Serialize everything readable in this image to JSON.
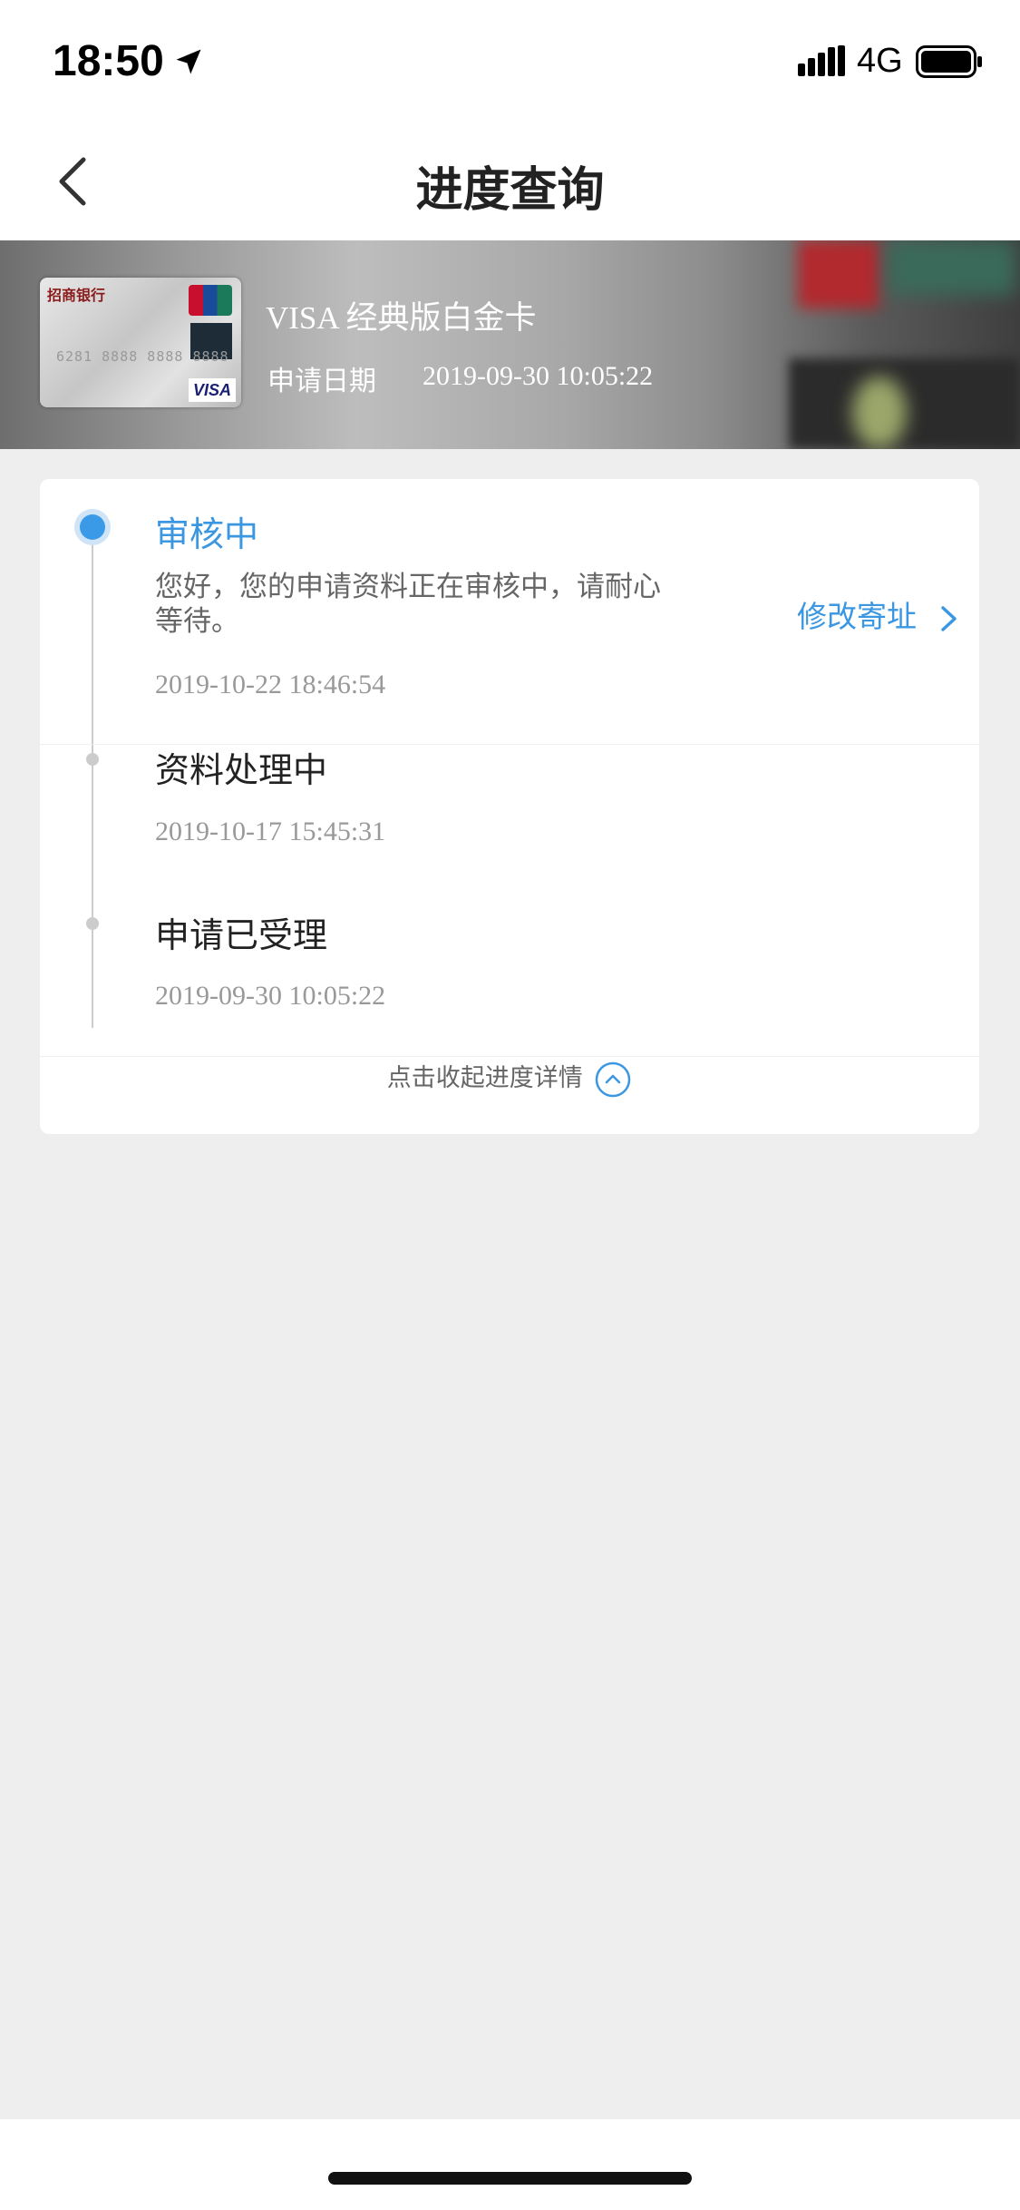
{
  "status_bar": {
    "time": "18:50",
    "network": "4G"
  },
  "nav": {
    "title": "进度查询"
  },
  "card": {
    "name": "VISA 经典版白金卡",
    "apply_label": "申请日期",
    "apply_date": "2019-09-30 10:05:22",
    "bank_mark": "招商银行",
    "number_mark": "6281 8888 8888 8888",
    "brand_mark": "VISA"
  },
  "steps": [
    {
      "title": "审核中",
      "desc": "您好，您的申请资料正在审核中，请耐心等待。",
      "time": "2019-10-22 18:46:54",
      "action": "修改寄址"
    },
    {
      "title": "资料处理中",
      "time": "2019-10-17 15:45:31"
    },
    {
      "title": "申请已受理",
      "time": "2019-09-30 10:05:22"
    }
  ],
  "collapse_label": "点击收起进度详情",
  "colors": {
    "accent": "#3b97e2",
    "background": "#eeeeee"
  },
  "icons": [
    "location-arrow-icon",
    "signal-icon",
    "battery-icon",
    "back-arrow-icon",
    "chevron-right-icon",
    "chevron-up-circle-icon"
  ]
}
